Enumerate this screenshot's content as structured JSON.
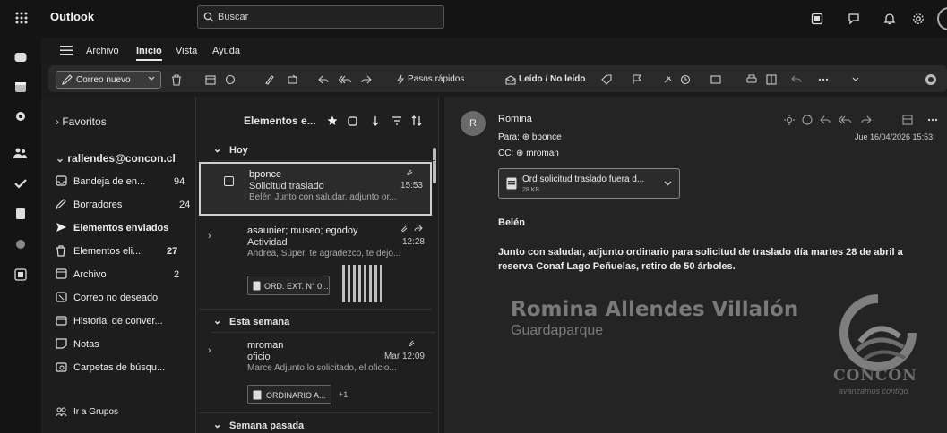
{
  "app": {
    "name": "Outlook"
  },
  "search": {
    "placeholder": "Buscar"
  },
  "menu": {
    "items": [
      "Archivo",
      "Inicio",
      "Vista",
      "Ayuda"
    ]
  },
  "ribbon": {
    "new_mail": "Correo nuevo",
    "quick_steps": "Pasos rápidos",
    "read_unread": "Leído / No leído"
  },
  "folders": {
    "favorites": "Favoritos",
    "account": "rallendes@concon.cl",
    "items": [
      {
        "label": "Bandeja de en...",
        "count": "94",
        "icon": "inbox-icon"
      },
      {
        "label": "Borradores",
        "count": "24",
        "icon": "pencil-icon"
      },
      {
        "label": "Elementos enviados",
        "count": "",
        "icon": "send-icon"
      },
      {
        "label": "Elementos eli...",
        "count": "27",
        "icon": "trash-icon"
      },
      {
        "label": "Archivo",
        "count": "2",
        "icon": "archive-icon"
      },
      {
        "label": "Correo no deseado",
        "count": "",
        "icon": "junk-icon"
      },
      {
        "label": "Historial de conver...",
        "count": "",
        "icon": "history-icon"
      },
      {
        "label": "Notas",
        "count": "",
        "icon": "notes-icon"
      },
      {
        "label": "Carpetas de búsqu...",
        "count": "",
        "icon": "search-folder-icon"
      }
    ],
    "groups": "Ir a Grupos"
  },
  "list": {
    "title": "Elementos e...",
    "groups": {
      "today": "Hoy",
      "this_week": "Esta semana",
      "last_week": "Semana pasada"
    },
    "messages": [
      {
        "from": "bponce",
        "subject": "Solicitud traslado",
        "time": "15:53",
        "preview": "Belén Junto con saludar, adjunto or..."
      },
      {
        "from": "asaunier; museo; egodoy",
        "subject": "Actividad",
        "time": "12:28",
        "preview": "Andrea, Súper, te agradezco, te dejo...",
        "attachment": "ORD. EXT. N° 0..."
      },
      {
        "from": "mroman",
        "subject": "oficio",
        "time": "Mar 12:09",
        "preview": "Marce Adjunto lo solicitado, el oficio...",
        "attachment": "ORDINARIO A...",
        "more": "+1"
      }
    ]
  },
  "reading": {
    "avatar": "R",
    "sender": "Romina",
    "to_label": "Para:",
    "to": "bponce",
    "cc_label": "CC:",
    "cc": "mroman",
    "date": "Jue 16/04/2026 15:53",
    "attachment_name": "Ord solicitud traslado fuera d...",
    "attachment_size": "28 KB",
    "greeting": "Belén",
    "body": "Junto con saludar, adjunto ordinario para solicitud de traslado día martes 28 de abril a reserva Conaf Lago Peñuelas, retiro de 50 árboles.",
    "signature_name": "Romina Allendes Villalón",
    "signature_title": "Guardaparque",
    "logo_text": "CONCÓN",
    "logo_tagline": "avanzamos contigo"
  }
}
